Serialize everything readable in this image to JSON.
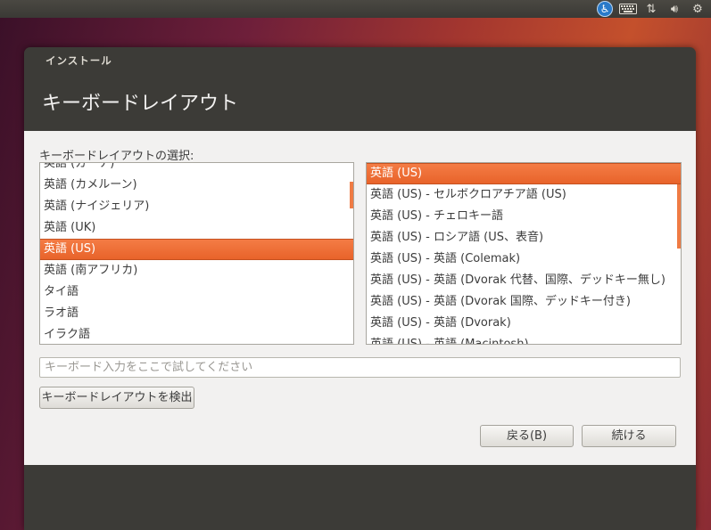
{
  "window": {
    "title": "インストール",
    "page_title": "キーボードレイアウト"
  },
  "layout_section": {
    "label": "キーボードレイアウトの選択:",
    "left_list": [
      {
        "label": "英語 (ガーナ)",
        "selected": false
      },
      {
        "label": "英語 (カメルーン)",
        "selected": false
      },
      {
        "label": "英語 (ナイジェリア)",
        "selected": false
      },
      {
        "label": "英語 (UK)",
        "selected": false
      },
      {
        "label": "英語 (US)",
        "selected": true
      },
      {
        "label": "英語 (南アフリカ)",
        "selected": false
      },
      {
        "label": "タイ語",
        "selected": false
      },
      {
        "label": "ラオ語",
        "selected": false
      },
      {
        "label": "イラク語",
        "selected": false
      }
    ],
    "right_list": [
      {
        "label": "英語 (US)",
        "selected": true
      },
      {
        "label": "英語 (US) - セルボクロアチア語 (US)",
        "selected": false
      },
      {
        "label": "英語 (US) - チェロキー語",
        "selected": false
      },
      {
        "label": "英語 (US) - ロシア語 (US、表音)",
        "selected": false
      },
      {
        "label": "英語 (US) - 英語 (Colemak)",
        "selected": false
      },
      {
        "label": "英語 (US) - 英語 (Dvorak 代替、国際、デッドキー無し)",
        "selected": false
      },
      {
        "label": "英語 (US) - 英語 (Dvorak 国際、デッドキー付き)",
        "selected": false
      },
      {
        "label": "英語 (US) - 英語 (Dvorak)",
        "selected": false
      },
      {
        "label": "英語 (US) - 英語 (Macintosh)",
        "selected": false
      }
    ]
  },
  "test_input": {
    "placeholder": "キーボード入力をここで試してください",
    "value": ""
  },
  "buttons": {
    "detect": "キーボードレイアウトを検出",
    "back": "戻る(B)",
    "continue": "続ける"
  },
  "top_panel": {
    "icons": [
      "accessibility-icon",
      "keyboard-icon",
      "network-icon",
      "volume-icon",
      "gear-icon"
    ]
  },
  "colors": {
    "selection": "#e8632a",
    "window_header": "#3c3b37",
    "content_bg": "#f2f1f0"
  }
}
